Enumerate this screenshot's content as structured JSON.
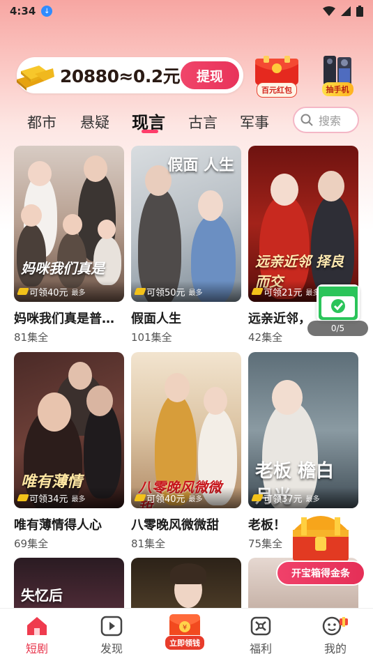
{
  "status_bar": {
    "time": "4:34"
  },
  "coin_bar": {
    "balance_text": "20880≈0.2元",
    "withdraw_label": "提现"
  },
  "promos": {
    "red_packet_label": "百元红包",
    "phone_label": "抽手机"
  },
  "tabs": [
    {
      "label": "都市"
    },
    {
      "label": "悬疑"
    },
    {
      "label": "现言",
      "active": true
    },
    {
      "label": "古言"
    },
    {
      "label": "军事"
    }
  ],
  "search": {
    "placeholder": "搜索"
  },
  "dramas": [
    {
      "title": "妈咪我们真是普…",
      "episodes": "81集全",
      "reward": "可领40元",
      "most": "最多",
      "poster_text": "妈咪我们真是"
    },
    {
      "title": "假面人生",
      "episodes": "101集全",
      "reward": "可领50元",
      "most": "最多",
      "poster_text": "假面 人生"
    },
    {
      "title": "远亲近邻，",
      "episodes": "42集全",
      "reward": "可领21元",
      "most": "最多",
      "poster_text": "远亲近邻 择良而交"
    },
    {
      "title": "唯有薄情得人心",
      "episodes": "69集全",
      "reward": "可领34元",
      "most": "最多",
      "poster_text": "唯有薄情"
    },
    {
      "title": "八零晚风微微甜",
      "episodes": "81集全",
      "reward": "可领40元",
      "most": "最多",
      "poster_text": "八零晚风微微甜"
    },
    {
      "title": "老板！",
      "episodes": "75集全",
      "reward": "可领37元",
      "most": "最多",
      "poster_text": "老板 檐白月光"
    },
    {
      "title": "",
      "episodes": "",
      "reward": "",
      "most": "",
      "poster_text": "失忆后"
    },
    {
      "title": "",
      "episodes": "",
      "reward": "",
      "most": "",
      "poster_text": ""
    },
    {
      "title": "",
      "episodes": "",
      "reward": "",
      "most": "",
      "poster_text": ""
    }
  ],
  "task_widget": {
    "progress": "0/5"
  },
  "treasure": {
    "label": "开宝箱得金条"
  },
  "bottom_nav": [
    {
      "label": "短剧",
      "active": true
    },
    {
      "label": "发现"
    },
    {
      "label": "立即领钱"
    },
    {
      "label": "福利"
    },
    {
      "label": "我的"
    }
  ],
  "colors": {
    "accent": "#e8334a",
    "tab_underline": "#ff3d6a",
    "withdraw": "#f0456a"
  }
}
